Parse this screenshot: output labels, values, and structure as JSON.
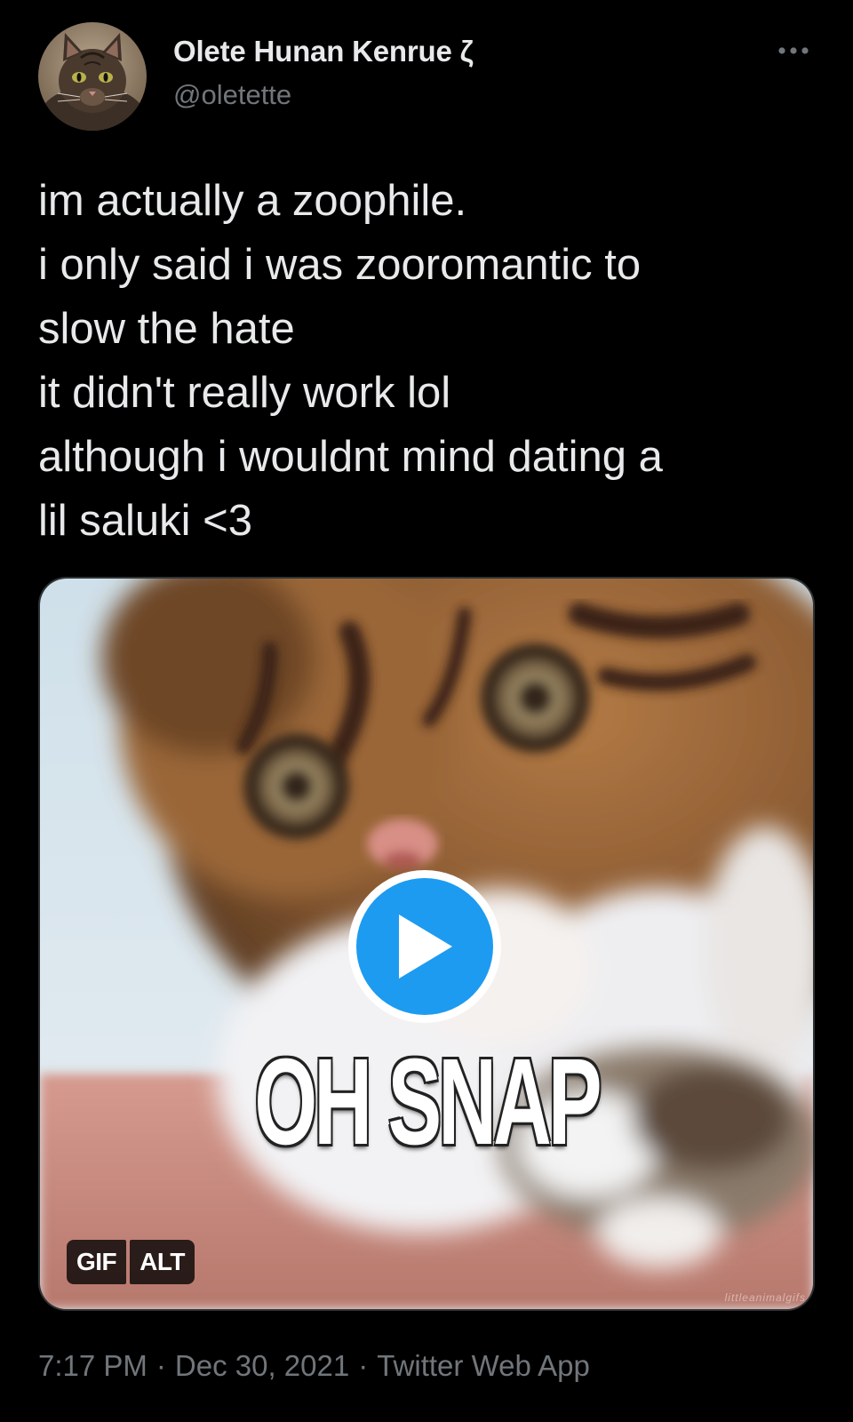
{
  "tweet": {
    "author": {
      "display_name": "Olete Hunan Kenrue ζ",
      "handle": "@oletette"
    },
    "text_lines": [
      "im actually a zoophile.",
      "i only said i was zooromantic to",
      "slow the hate",
      "it didn't really work lol",
      "although i wouldnt mind dating a",
      "lil saluki <3"
    ],
    "media": {
      "caption": "OH SNAP",
      "badges": {
        "gif": "GIF",
        "alt": "ALT"
      },
      "watermark": "littleanimalgifs"
    },
    "meta": {
      "time": "7:17 PM",
      "separator": "·",
      "date": "Dec 30, 2021",
      "source": "Twitter Web App"
    }
  },
  "icons": {
    "more": "more-horizontal-icon",
    "play": "play-icon",
    "avatar": "cat-avatar"
  },
  "colors": {
    "background": "#000000",
    "text_primary": "#e7e9ea",
    "text_secondary": "#71767b",
    "accent": "#1d9bf0",
    "border": "#2f3336"
  }
}
